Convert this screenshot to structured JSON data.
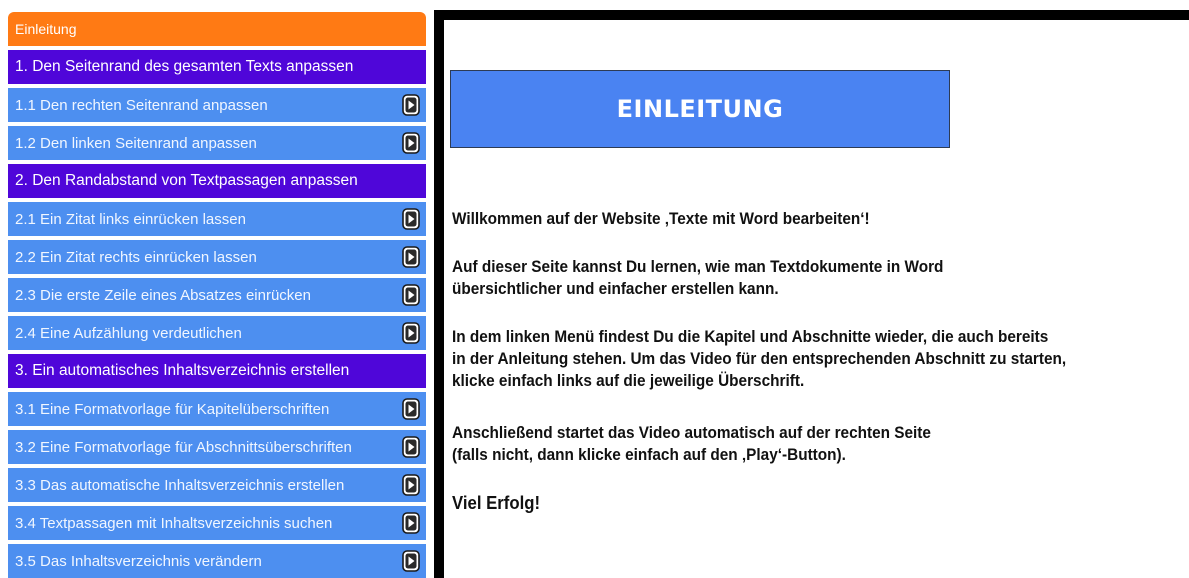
{
  "sidebar": {
    "items": [
      {
        "type": "intro",
        "label": "Einleitung"
      },
      {
        "type": "chapter",
        "label": "1. Den Seitenrand des gesamten Texts anpassen"
      },
      {
        "type": "section",
        "label": "1.1 Den rechten Seitenrand anpassen",
        "icon": "play-icon"
      },
      {
        "type": "section",
        "label": "1.2 Den linken Seitenrand anpassen",
        "icon": "play-icon"
      },
      {
        "type": "chapter",
        "label": "2. Den Randabstand von Textpassagen anpassen"
      },
      {
        "type": "section",
        "label": "2.1 Ein Zitat links einrücken lassen",
        "icon": "play-icon"
      },
      {
        "type": "section",
        "label": "2.2 Ein Zitat rechts einrücken lassen",
        "icon": "play-icon"
      },
      {
        "type": "section",
        "label": "2.3 Die erste Zeile eines Absatzes einrücken",
        "icon": "play-icon"
      },
      {
        "type": "section",
        "label": "2.4 Eine Aufzählung verdeutlichen",
        "icon": "play-icon"
      },
      {
        "type": "chapter",
        "label": "3. Ein automatisches Inhaltsverzeichnis erstellen"
      },
      {
        "type": "section",
        "label": "3.1 Eine Formatvorlage für Kapitelüberschriften",
        "icon": "play-icon"
      },
      {
        "type": "section",
        "label": "3.2 Eine Formatvorlage für Abschnittsüberschriften",
        "icon": "play-icon"
      },
      {
        "type": "section",
        "label": "3.3 Das automatische Inhaltsverzeichnis erstellen",
        "icon": "play-icon"
      },
      {
        "type": "section",
        "label": "3.4 Textpassagen mit Inhaltsverzeichnis suchen",
        "icon": "play-icon"
      },
      {
        "type": "section",
        "label": "3.5 Das Inhaltsverzeichnis verändern",
        "icon": "play-icon"
      }
    ]
  },
  "content": {
    "title": "EINLEITUNG",
    "welcome": "Willkommen auf der Website ‚Texte mit Word bearbeiten‘!",
    "learn_line1": "Auf dieser Seite kannst Du lernen, wie man Textdokumente in Word",
    "learn_line2": "übersichtlicher und einfacher erstellen kann.",
    "menu_line1": "In dem linken Menü findest Du die Kapitel und Abschnitte wieder, die auch bereits",
    "menu_line2": "in der Anleitung stehen. Um das Video für den entsprechenden Abschnitt zu starten,",
    "menu_line3": "klicke einfach links auf die jeweilige Überschrift.",
    "after_line1": "Anschließend startet das Video automatisch auf der rechten Seite",
    "after_line2": "(falls nicht, dann klicke einfach auf den ‚Play‘-Button).",
    "luck": "Viel Erfolg!"
  },
  "colors": {
    "intro": "#ff7a14",
    "chapter": "#4f06d9",
    "section": "#4d8ff0",
    "title_box": "#4a83f2"
  }
}
